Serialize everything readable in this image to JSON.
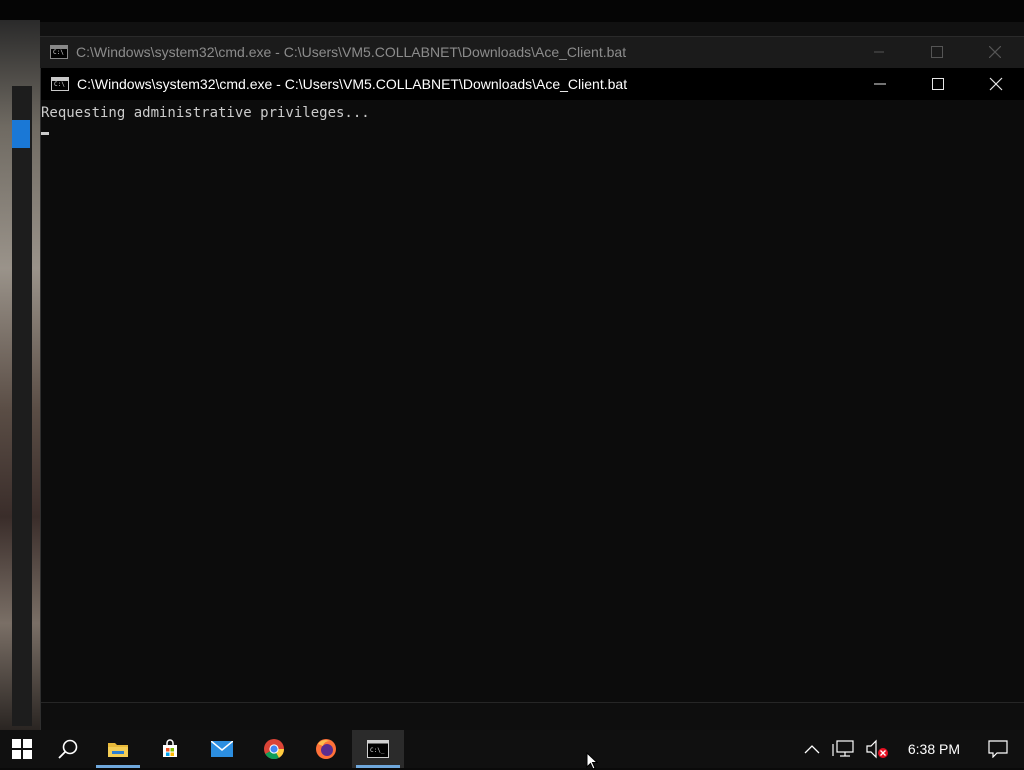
{
  "back_window": {
    "title": "C:\\Windows\\system32\\cmd.exe - C:\\Users\\VM5.COLLABNET\\Downloads\\Ace_Client.bat",
    "icon_text": "C:\\"
  },
  "front_window": {
    "title": "C:\\Windows\\system32\\cmd.exe - C:\\Users\\VM5.COLLABNET\\Downloads\\Ace_Client.bat",
    "icon_text": "C:\\",
    "console_lines": [
      "Requesting administrative privileges..."
    ]
  },
  "taskbar": {
    "apps": [
      "start",
      "search",
      "file-explorer",
      "microsoft-store",
      "mail",
      "chrome",
      "firefox",
      "command-prompt"
    ],
    "clock": "6:38 PM"
  },
  "colors": {
    "console_bg": "#0c0c0c",
    "console_text": "#cccccc",
    "taskbar_bg": "#101010",
    "running_indicator": "#6fa8dc"
  }
}
